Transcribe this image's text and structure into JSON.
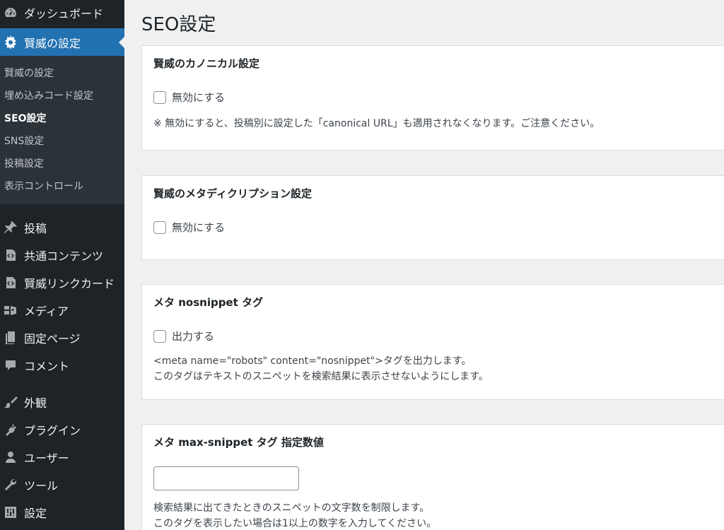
{
  "sidebar": {
    "dashboard": "ダッシュボード",
    "kenshi_settings": "賢威の設定",
    "submenu": [
      "賢威の設定",
      "埋め込みコード設定",
      "SEO設定",
      "SNS設定",
      "投稿設定",
      "表示コントロール"
    ],
    "posts": "投稿",
    "common_contents": "共通コンテンツ",
    "link_card": "賢威リンクカード",
    "media": "メディア",
    "pages": "固定ページ",
    "comments": "コメント",
    "appearance": "外観",
    "plugins": "プラグイン",
    "users": "ユーザー",
    "tools": "ツール",
    "settings": "設定"
  },
  "page": {
    "title": "SEO設定"
  },
  "cards": {
    "canonical": {
      "title": "賢威のカノニカル設定",
      "checkbox_label": "無効にする",
      "checked": false,
      "note": "※ 無効にすると、投稿別に設定した「canonical URL」も適用されなくなります。ご注意ください。"
    },
    "meta_description": {
      "title": "賢威のメタディクリプション設定",
      "checkbox_label": "無効にする",
      "checked": false
    },
    "nosnippet": {
      "title": "メタ nosnippet タグ",
      "checkbox_label": "出力する",
      "checked": false,
      "desc_line1": "<meta name=\"robots\" content=\"nosnippet\">タグを出力します。",
      "desc_line2": "このタグはテキストのスニペットを検索結果に表示させないようにします。"
    },
    "max_snippet": {
      "title": "メタ max-snippet タグ 指定数値",
      "value": "",
      "desc_line1": "検索結果に出てきたときのスニペットの文字数を制限します。",
      "desc_line2": "このタグを表示したい場合は1以上の数字を入力してください。"
    }
  },
  "colors": {
    "sidebar_bg": "#1d2327",
    "submenu_bg": "#2c3338",
    "accent": "#2271b1",
    "page_bg": "#f0f0f1"
  }
}
